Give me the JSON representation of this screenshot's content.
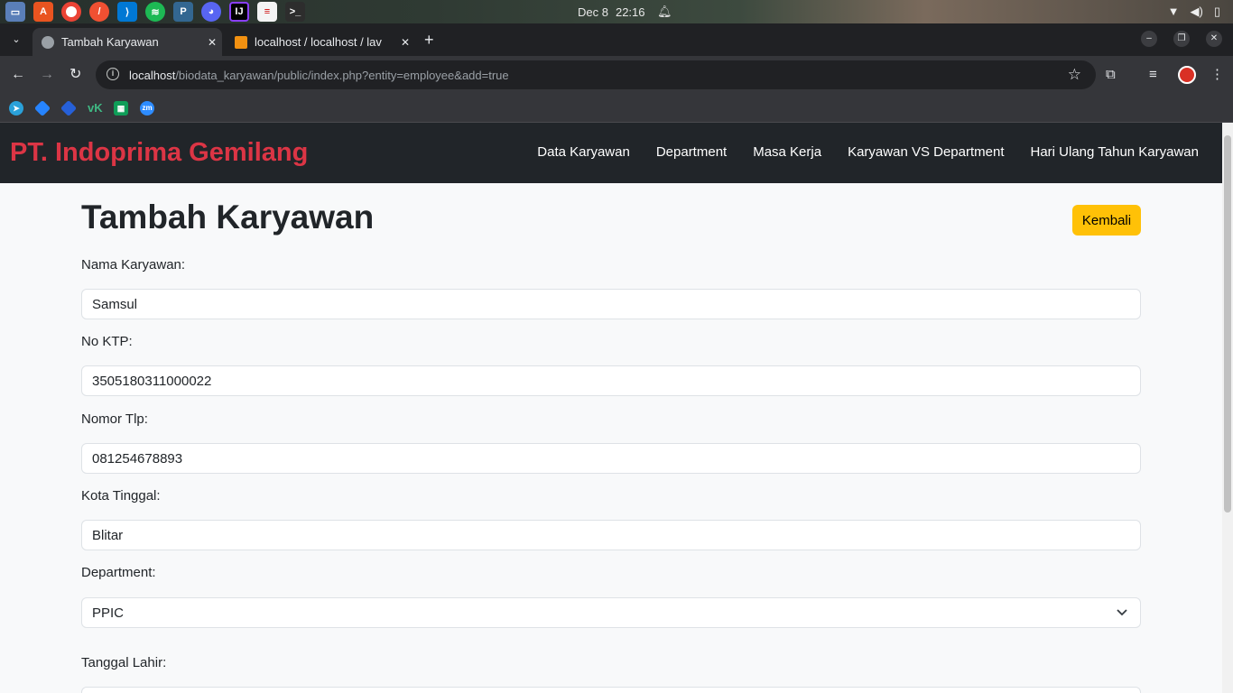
{
  "os": {
    "date": "Dec 8",
    "time": "22:16"
  },
  "browser": {
    "tabs": [
      {
        "label": "Tambah Karyawan"
      },
      {
        "label": "localhost / localhost / lav"
      }
    ],
    "url": {
      "host": "localhost",
      "path": "/biodata_karyawan/public/index.php?entity=employee&add=true"
    },
    "bookmarks": [
      "telegram-icon",
      "jira-icon",
      "jira-icon",
      "vk-icon",
      "sheets-icon",
      "zoom-icon"
    ]
  },
  "app": {
    "brand": "PT. Indoprima Gemilang",
    "nav": [
      {
        "label": "Data Karyawan"
      },
      {
        "label": "Department"
      },
      {
        "label": "Masa Kerja"
      },
      {
        "label": "Karyawan VS Department"
      },
      {
        "label": "Hari Ulang Tahun Karyawan"
      }
    ]
  },
  "form": {
    "title": "Tambah Karyawan",
    "back_label": "Kembali",
    "fields": {
      "nama": {
        "label": "Nama Karyawan:",
        "value": "Samsul"
      },
      "ktp": {
        "label": "No KTP:",
        "value": "3505180311000022"
      },
      "tlp": {
        "label": "Nomor Tlp:",
        "value": "081254678893"
      },
      "kota": {
        "label": "Kota Tinggal:",
        "value": "Blitar"
      },
      "department": {
        "label": "Department:",
        "value": "PPIC"
      },
      "lahir": {
        "label": "Tanggal Lahir:"
      }
    }
  },
  "colors": {
    "brand": "#dc3545",
    "navbar": "#212529",
    "back_button": "#ffc107"
  }
}
